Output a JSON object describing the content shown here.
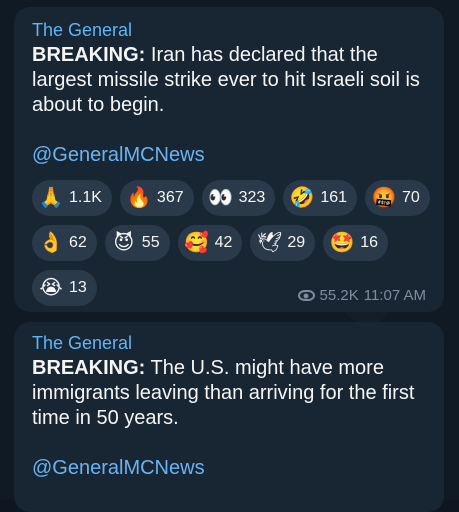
{
  "messages": [
    {
      "sender": "The General",
      "breaking_label": "BREAKING:",
      "text": " Iran has declared that the largest missile strike ever to hit Israeli soil is about to begin.",
      "handle": "@GeneralMCNews",
      "reactions": [
        {
          "icon": "folded-hands-icon",
          "glyph": "🙏",
          "count": "1.1K"
        },
        {
          "icon": "fire-icon",
          "glyph": "🔥",
          "count": "367"
        },
        {
          "icon": "eyes-icon",
          "glyph": "👀",
          "count": "323"
        },
        {
          "icon": "rolling-laughing-icon",
          "glyph": "🤣",
          "count": "161"
        },
        {
          "icon": "cursing-face-icon",
          "glyph": "🤬",
          "count": "70"
        },
        {
          "icon": "ok-hand-icon",
          "glyph": "👌",
          "count": "62"
        },
        {
          "icon": "smiling-devil-icon",
          "glyph": "😈",
          "count": "55"
        },
        {
          "icon": "smiling-hearts-icon",
          "glyph": "🥰",
          "count": "42"
        },
        {
          "icon": "dove-icon",
          "glyph": "🕊",
          "count": "29"
        },
        {
          "icon": "star-struck-icon",
          "glyph": "🤩",
          "count": "16"
        },
        {
          "icon": "crying-loudly-icon",
          "glyph": "😭",
          "count": "13"
        }
      ],
      "views": "55.2K",
      "time": "11:07 AM"
    },
    {
      "sender": "The General",
      "breaking_label": "BREAKING:",
      "text": " The U.S. might have more immigrants leaving than arriving for the first time in 50 years.",
      "handle": "@GeneralMCNews"
    }
  ],
  "colors": {
    "background": "#0e1621",
    "bubble": "#182533",
    "sender": "#5eb5f7",
    "link": "#6ab3f3",
    "reaction_chip": "#2b3a4a",
    "meta": "#7e8d9c"
  }
}
